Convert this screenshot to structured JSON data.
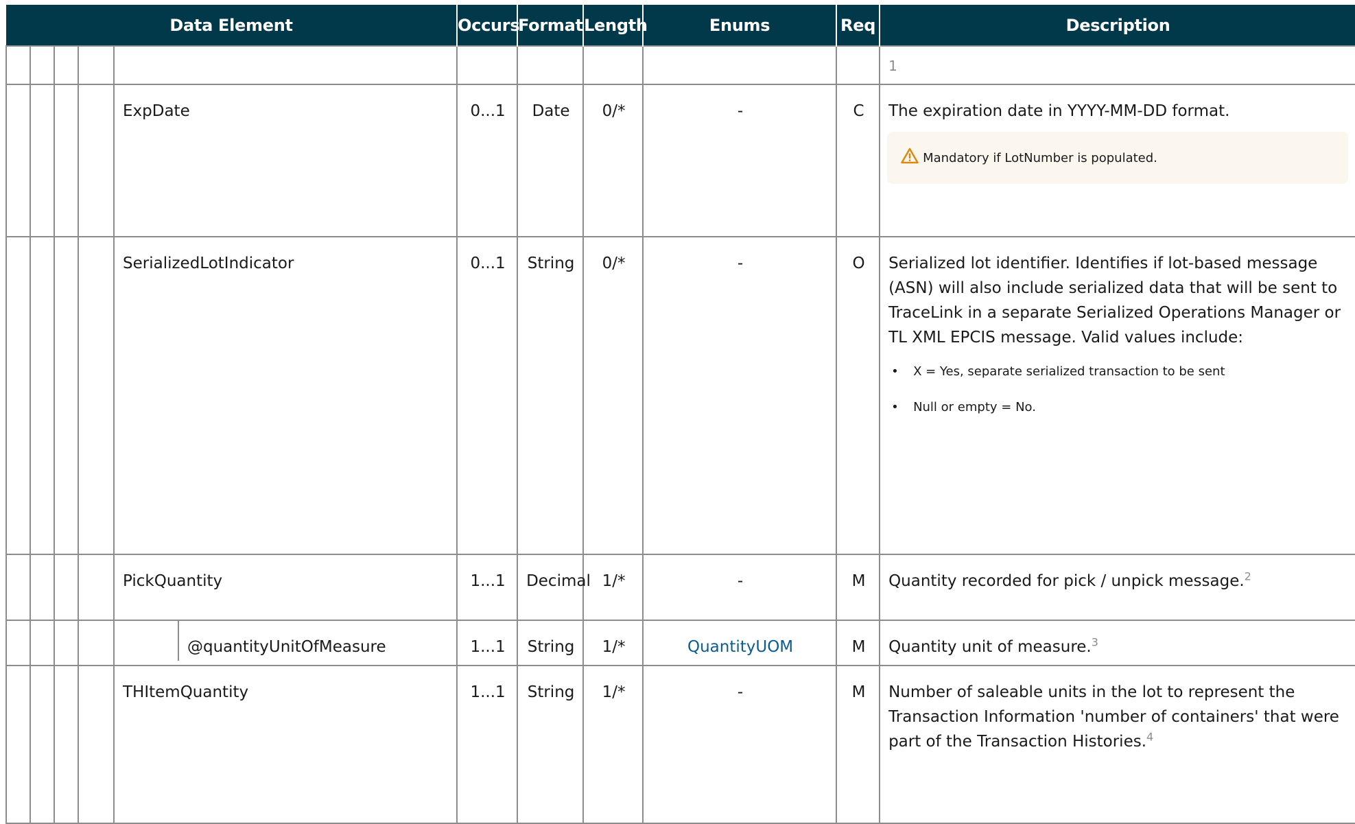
{
  "headers": {
    "data_element": "Data Element",
    "occurs": "Occurs",
    "format": "Format",
    "length": "Length",
    "enums": "Enums",
    "req": "Req",
    "description": "Description"
  },
  "top_row": {
    "description_fragment": "1"
  },
  "rows": [
    {
      "name": "ExpDate",
      "occurs": "0...1",
      "format": "Date",
      "length": "0/*",
      "enums": "-",
      "req": "C",
      "description": "The expiration date in YYYY-MM-DD format.",
      "note": "Mandatory if LotNumber is populated.",
      "note_icon": "warning-triangle-icon"
    },
    {
      "name": "SerializedLotIndicator",
      "occurs": "0...1",
      "format": "String",
      "length": "0/*",
      "enums": "-",
      "req": "O",
      "description": "Serialized lot identifier. Identifies if lot-based message (ASN) will also include serialized data that will be sent to TraceLink in a separate Serialized Operations Manager or TL XML EPCIS message. Valid values include:",
      "values": [
        "X = Yes, separate serialized transaction to be sent",
        "Null or empty = No."
      ]
    },
    {
      "name": "PickQuantity",
      "occurs": "1...1",
      "format": "Decimal",
      "length": "1/*",
      "enums": "-",
      "req": "M",
      "description": "Quantity recorded for pick / unpick message.",
      "footnote": "2"
    },
    {
      "name": "@quantityUnitOfMeasure",
      "occurs": "1...1",
      "format": "String",
      "length": "1/*",
      "enums": "QuantityUOM",
      "req": "M",
      "description": "Quantity unit of measure.",
      "footnote": "3"
    },
    {
      "name": "THItemQuantity",
      "occurs": "1...1",
      "format": "String",
      "length": "1/*",
      "enums": "-",
      "req": "M",
      "description": "Number of saleable units in the lot to represent the Transaction Information 'number of containers' that were part of the Transaction Histories.",
      "footnote": "4"
    }
  ],
  "colors": {
    "header_bg": "#02394a",
    "link": "#0a5c93",
    "note_bg": "#fbf7ef",
    "warn_icon": "#d98a10"
  }
}
